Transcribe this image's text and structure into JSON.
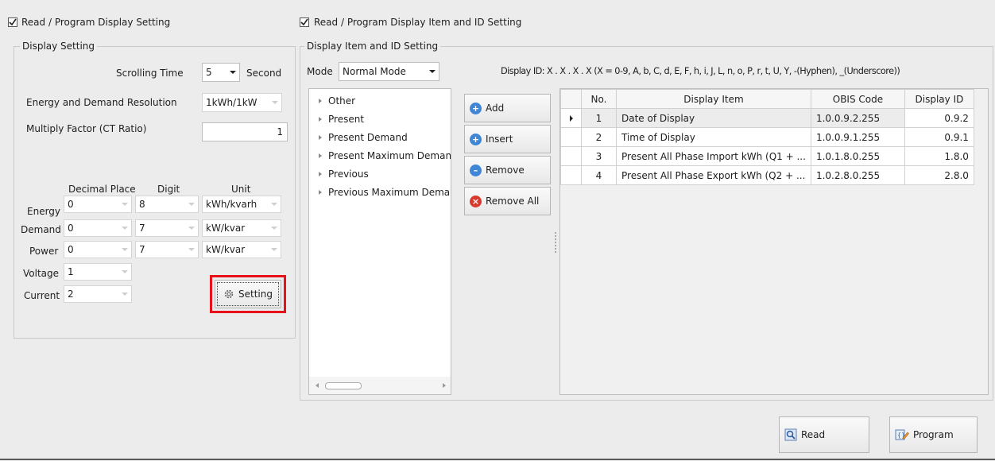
{
  "left": {
    "header_label": "Read / Program Display Setting",
    "group_title": "Display Setting",
    "scrolling_time_label": "Scrolling Time",
    "scrolling_time_value": "5",
    "second_label": "Second",
    "resolution_label": "Energy and Demand Resolution",
    "resolution_value": "1kWh/1kW",
    "multiply_label": "Multiply Factor (CT Ratio)",
    "multiply_value": "1",
    "col_decimal": "Decimal Place",
    "col_digit": "Digit",
    "col_unit": "Unit",
    "rows": [
      {
        "label": "Energy",
        "decimal": "0",
        "digit": "8",
        "unit": "kWh/kvarh"
      },
      {
        "label": "Demand",
        "decimal": "0",
        "digit": "7",
        "unit": "kW/kvar"
      },
      {
        "label": "Power",
        "decimal": "0",
        "digit": "7",
        "unit": "kW/kvar"
      },
      {
        "label": "Voltage",
        "decimal": "1"
      },
      {
        "label": "Current",
        "decimal": "2"
      }
    ],
    "setting_button": "Setting"
  },
  "right": {
    "header_label": "Read / Program Display Item and ID Setting",
    "group_title": "Display Item and ID Setting",
    "mode_label": "Mode",
    "mode_value": "Normal Mode",
    "display_id_hint": "Display ID: X . X . X . X  (X = 0-9, A, b, C, d, E, F, h, i, J, L, n, o, P, r, t, U, Y, -(Hyphen), _(Underscore))",
    "tree_items": [
      "Other",
      "Present",
      "Present Demand",
      "Present Maximum Deman",
      "Previous",
      "Previous Maximum Demar"
    ],
    "buttons": {
      "add": "Add",
      "insert": "Insert",
      "remove": "Remove",
      "remove_all": "Remove All"
    },
    "table": {
      "headers": [
        "No.",
        "Display Item",
        "OBIS Code",
        "Display ID"
      ],
      "rows": [
        {
          "no": "1",
          "item": "Date of Display",
          "obis": "1.0.0.9.2.255",
          "id": "0.9.2"
        },
        {
          "no": "2",
          "item": "Time of Display",
          "obis": "1.0.0.9.1.255",
          "id": "0.9.1"
        },
        {
          "no": "3",
          "item": "Present All Phase Import kWh (Q1 + ...",
          "obis": "1.0.1.8.0.255",
          "id": "1.8.0"
        },
        {
          "no": "4",
          "item": "Present All Phase Export kWh (Q2 + ...",
          "obis": "1.0.2.8.0.255",
          "id": "2.8.0"
        }
      ]
    }
  },
  "bottom": {
    "read_button": "Read",
    "program_button": "Program"
  },
  "colors": {
    "highlight": "#e8101a",
    "add_icon": "#3f86d6",
    "remove_all_icon": "#d83a2e"
  }
}
